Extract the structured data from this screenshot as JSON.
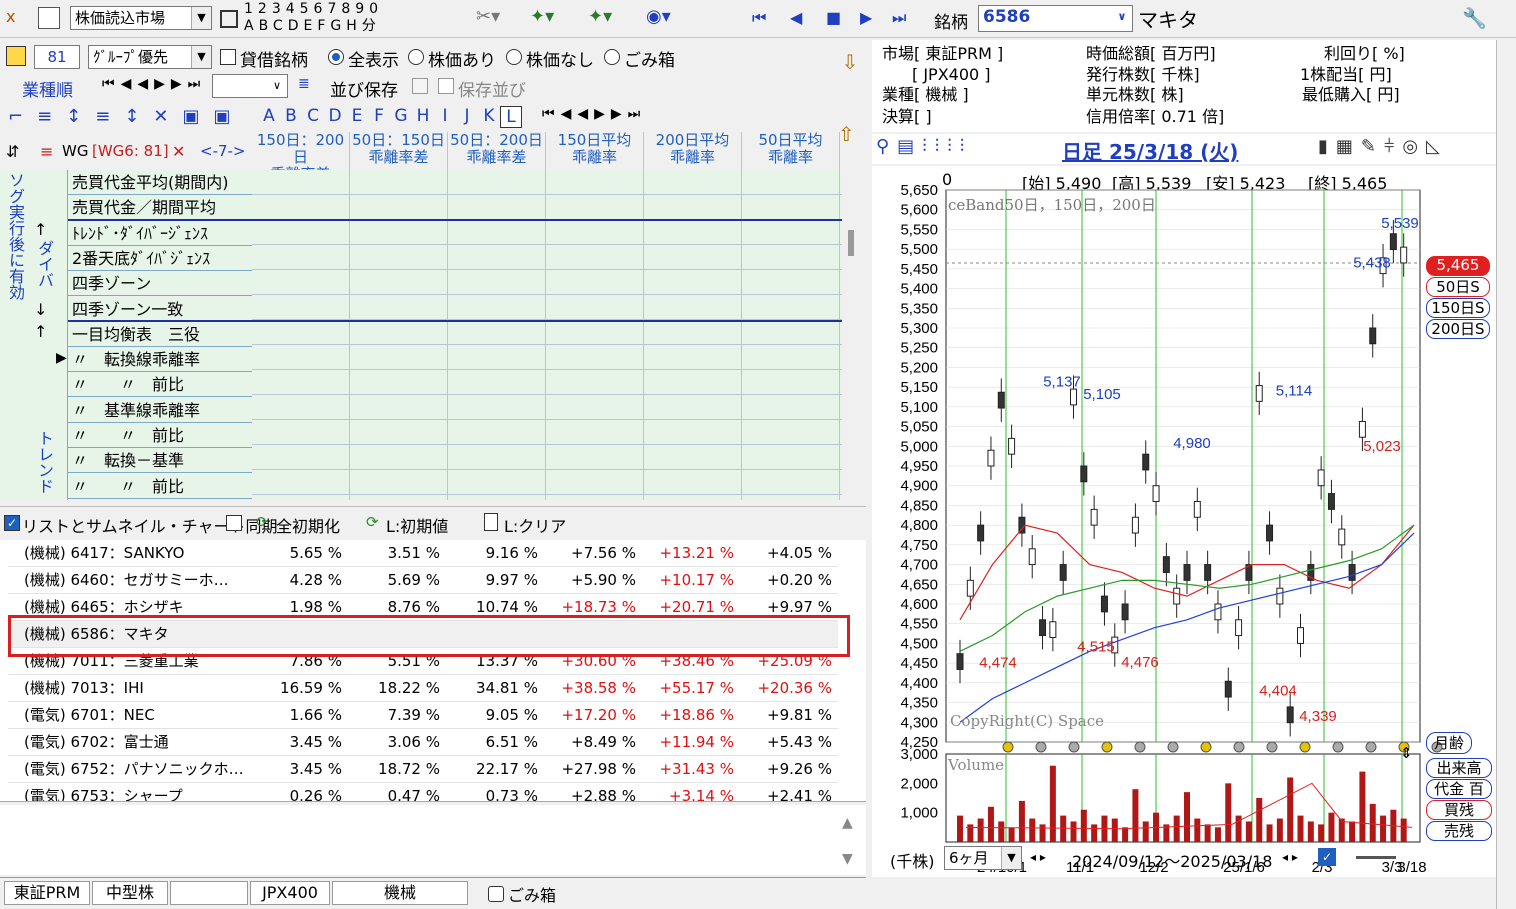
{
  "toolbar": {
    "market_select": "株価読込市場",
    "digits_top": "1234567890",
    "letters_bottom": "ABCDEFGH分",
    "stock_label": "銘柄",
    "stock_code": "6586",
    "stock_name": "マキタ"
  },
  "left_panel": {
    "count": "81",
    "group_select": "ｸﾞﾙｰﾌﾟ優先",
    "chk_lending": "貸借銘柄",
    "radio_all": "全表示",
    "radio_with_price": "株価あり",
    "radio_no_price": "株価なし",
    "radio_trash": "ごみ箱",
    "sort_label": "業種順",
    "save_sort": "並び保存",
    "saved_sort": "保存並び",
    "letters": [
      "A",
      "B",
      "C",
      "D",
      "E",
      "F",
      "G",
      "H",
      "I",
      "J",
      "K",
      "L"
    ],
    "wg_label": "WG",
    "wg_value": "[WG6: 81]",
    "page_label": "<-7->",
    "vertical_left": "ソグ実行後に有効",
    "vertical_div": "ダイバ",
    "vertical_trend": "トレンド"
  },
  "columns": [
    {
      "l1": "150日：200日",
      "l2": "乖離率差"
    },
    {
      "l1": "50日：150日",
      "l2": "乖離率差"
    },
    {
      "l1": "50日：200日",
      "l2": "乖離率差"
    },
    {
      "l1": "150日平均",
      "l2": "乖離率"
    },
    {
      "l1": "200日平均",
      "l2": "乖離率"
    },
    {
      "l1": "50日平均",
      "l2": "乖離率"
    }
  ],
  "grid_rows": [
    "売買代金平均(期間内)",
    "売買代金／期間平均",
    "ﾄﾚﾝﾄﾞ･ﾀﾞｲﾊﾞｰｼﾞｪﾝｽ",
    "2番天底ﾀﾞｲﾊﾞｼﾞｪﾝｽ",
    "四季ゾーン",
    "四季ゾーン一致",
    "一目均衡表　三役",
    "〃　転換線乖離率",
    "〃　　〃　前比",
    "〃　基準線乖離率",
    "〃　　〃　前比",
    "〃　転換－基準",
    "〃　　〃　前比"
  ],
  "sync_bar": {
    "sync": "リストとサムネイル・チャート同期",
    "init_all": "全初期化",
    "init_l": "L:初期値",
    "clear_l": "L:クリア"
  },
  "stock_rows": [
    {
      "name": "(機械) 6417：SANKYO",
      "c1": "5.65 %",
      "c2": "3.51 %",
      "c3": "9.16 %",
      "c4": "+7.56 %",
      "c5": "+13.21 %",
      "c6": "+4.05 %"
    },
    {
      "name": "(機械) 6460：セガサミーホ…",
      "c1": "4.28 %",
      "c2": "5.69 %",
      "c3": "9.97 %",
      "c4": "+5.90 %",
      "c5": "+10.17 %",
      "c6": "+0.20 %"
    },
    {
      "name": "(機械) 6465：ホシザキ",
      "c1": "1.98 %",
      "c2": "8.76 %",
      "c3": "10.74 %",
      "c4": "+18.73 %",
      "c5": "+20.71 %",
      "c6": "+9.97 %"
    },
    {
      "name": "(機械) 6586：マキタ",
      "c1": "",
      "c2": "",
      "c3": "",
      "c4": "",
      "c5": "",
      "c6": ""
    },
    {
      "name": "(機械) 7011：三菱重工業",
      "c1": "7.86 %",
      "c2": "5.51 %",
      "c3": "13.37 %",
      "c4": "+30.60 %",
      "c5": "+38.46 %",
      "c6": "+25.09 %"
    },
    {
      "name": "(機械) 7013：IHI",
      "c1": "16.59 %",
      "c2": "18.22 %",
      "c3": "34.81 %",
      "c4": "+38.58 %",
      "c5": "+55.17 %",
      "c6": "+20.36 %"
    },
    {
      "name": "(電気) 6701：NEC",
      "c1": "1.66 %",
      "c2": "7.39 %",
      "c3": "9.05 %",
      "c4": "+17.20 %",
      "c5": "+18.86 %",
      "c6": "+9.81 %"
    },
    {
      "name": "(電気) 6702：富士通",
      "c1": "3.45 %",
      "c2": "3.06 %",
      "c3": "6.51 %",
      "c4": "+8.49 %",
      "c5": "+11.94 %",
      "c6": "+5.43 %"
    },
    {
      "name": "(電気) 6752：パナソニックホ…",
      "c1": "3.45 %",
      "c2": "18.72 %",
      "c3": "22.17 %",
      "c4": "+27.98 %",
      "c5": "+31.43 %",
      "c6": "+9.26 %"
    },
    {
      "name": "(電気) 6753：シャープ",
      "c1": "0.26 %",
      "c2": "0.47 %",
      "c3": "0.73 %",
      "c4": "+2.88 %",
      "c5": "+3.14 %",
      "c6": "+2.41 %"
    }
  ],
  "status_bar": {
    "market": "東証PRM",
    "size": "中型株",
    "blank": "",
    "index": "JPX400",
    "sector": "機械",
    "trash": "ごみ箱"
  },
  "info": {
    "market": "市場[ 東証PRM ]",
    "index": "[ JPX400 ]",
    "sector": "業種[ 機械 ]",
    "settle": "決算[ ]",
    "mcap": "時価総額[ 百万円]",
    "shares": "発行株数[ 千株]",
    "unit": "単元株数[ 株]",
    "margin": "信用倍率[ 0.71 倍]",
    "yield": "利回り[ %]",
    "dividend": "1株配当[ 円]",
    "min_buy": "最低購入[ 円]"
  },
  "chart_header": {
    "title": "日足 25/3/18 (火)",
    "open": "[始] 5,490",
    "high": "[高] 5,539",
    "low": "[安] 5,423",
    "close": "[終] 5,465",
    "band_label": "ceBand50日，150日，200日",
    "copyright": "CopyRight(C) Space",
    "volume_label": "Volume",
    "unit_label": "(千株)",
    "period_select": "6ヶ月",
    "date_range": "2024/09/12～2025/03/18",
    "left_zero": "0",
    "month_label": "月齢"
  },
  "legend_buttons": [
    "5,465",
    "50日S",
    "150日S",
    "200日S"
  ],
  "volume_buttons": [
    "出来高",
    "代金 百",
    "買残",
    "売残"
  ],
  "chart_data": [
    {
      "type": "candlestick",
      "title": "日足 25/3/18 (火)",
      "ylim": [
        4250,
        5650
      ],
      "yticks": [
        5650,
        5600,
        5550,
        5500,
        5450,
        5400,
        5350,
        5300,
        5250,
        5200,
        5150,
        5100,
        5050,
        5000,
        4950,
        4900,
        4850,
        4800,
        4750,
        4700,
        4650,
        4600,
        4550,
        4500,
        4450,
        4400,
        4350,
        4300,
        4250
      ],
      "xticks": [
        "24/10/1",
        "11/1",
        "12/2",
        "25/1/6",
        "2/3",
        "3/3",
        "3/18"
      ],
      "annotations": [
        {
          "label": "5,137",
          "value": 5137
        },
        {
          "label": "5,105",
          "value": 5105
        },
        {
          "label": "4,980",
          "value": 4980
        },
        {
          "label": "5,114",
          "value": 5114
        },
        {
          "label": "5,438",
          "value": 5438
        },
        {
          "label": "5,539",
          "value": 5539
        },
        {
          "label": "5,023",
          "value": 5023
        },
        {
          "label": "4,474",
          "value": 4474
        },
        {
          "label": "4,515",
          "value": 4515
        },
        {
          "label": "4,476",
          "value": 4476
        },
        {
          "label": "4,404",
          "value": 4404
        },
        {
          "label": "4,339",
          "value": 4339
        }
      ],
      "last_close": 5465
    },
    {
      "type": "bar",
      "title": "Volume",
      "ylim": [
        0,
        3000
      ],
      "yticks": [
        "3,000",
        "2,000",
        "1,000"
      ]
    }
  ],
  "colors": {
    "panel_green": "#e6f5e8",
    "highlight_red": "#d92020",
    "candle_dark": "#1a1a1a",
    "ma50": "#e02020",
    "ma150": "#2a9a2a",
    "ma200": "#1f3fd8"
  }
}
